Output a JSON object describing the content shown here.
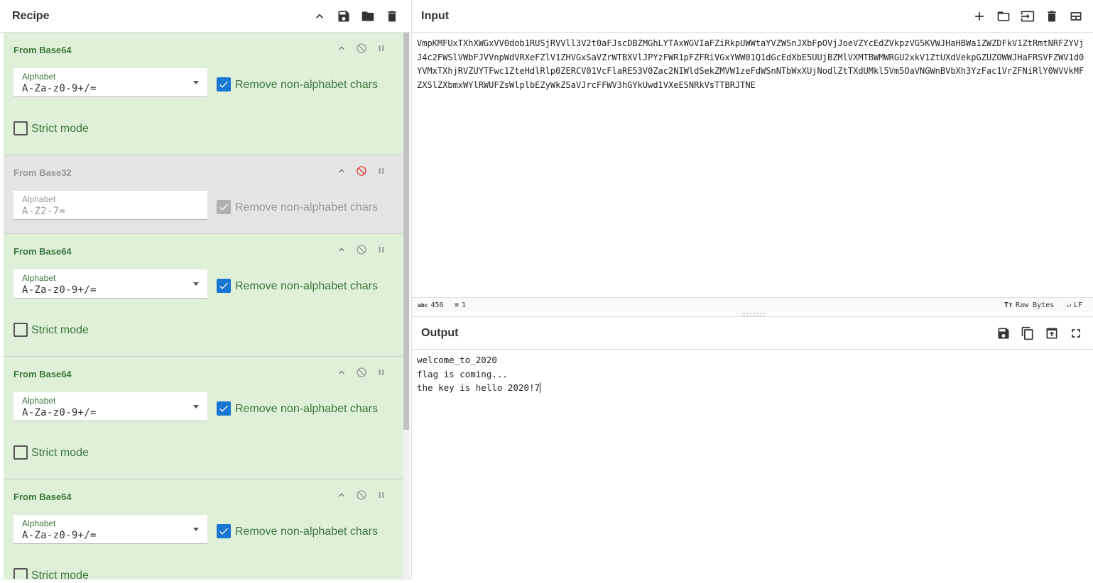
{
  "recipe": {
    "title": "Recipe",
    "header_icons": [
      "chevron-up-icon",
      "save-icon",
      "folder-icon",
      "trash-icon"
    ],
    "operations": [
      {
        "name": "From Base64",
        "disabled": false,
        "alphabet_label": "Alphabet",
        "alphabet": "A-Za-z0-9+/=",
        "remove_label": "Remove non-alphabet chars",
        "remove_checked": true,
        "strict_label": "Strict mode",
        "strict_checked": false
      },
      {
        "name": "From Base32",
        "disabled": true,
        "alphabet_label": "Alphabet",
        "alphabet": "A-Z2-7=",
        "remove_label": "Remove non-alphabet chars",
        "remove_checked": true
      },
      {
        "name": "From Base64",
        "disabled": false,
        "alphabet_label": "Alphabet",
        "alphabet": "A-Za-z0-9+/=",
        "remove_label": "Remove non-alphabet chars",
        "remove_checked": true,
        "strict_label": "Strict mode",
        "strict_checked": false
      },
      {
        "name": "From Base64",
        "disabled": false,
        "alphabet_label": "Alphabet",
        "alphabet": "A-Za-z0-9+/=",
        "remove_label": "Remove non-alphabet chars",
        "remove_checked": true,
        "strict_label": "Strict mode",
        "strict_checked": false
      },
      {
        "name": "From Base64",
        "disabled": false,
        "alphabet_label": "Alphabet",
        "alphabet": "A-Za-z0-9+/=",
        "remove_label": "Remove non-alphabet chars",
        "remove_checked": true,
        "strict_label": "Strict mode",
        "strict_checked": false
      }
    ]
  },
  "input": {
    "title": "Input",
    "header_icons": [
      "plus-icon",
      "folder-icon",
      "import-icon",
      "trash-icon",
      "layout-icon"
    ],
    "text": "VmpKMFUxTXhXWGxVV0dob1RUSjRVVll3V2t0aFJscDBZMGhLYTAxWGVIaFZiRkpUWWtaYVZWSnJXbFpOVjJoeVZYcEdZVkpzVG5KVWJHaHBWa1ZWZDFkV1ZtRmtNRFZYVjJ4c2FWSlVWbFJVVnpWdVRXeFZlV1ZHVGxSaVZrWTBXVlJPYzFWR1pFZFRiVGxYWW01Q1dGcEdXbE5UUjBZMlVXMTBWMWRGU2xkV1ZtUXdVekpGZUZOWWJHaFRSVFZWV1d0YVMxTXhjRVZUYTFwc1ZteHdlRlp0ZERCV01VcFlaRE53V0Zac2NIWldSekZMVW1zeFdWSnNTbWxXUjNodlZtTXdUMkl5Vm5OaVNGWnBVbXh3YzFac1VrZFNiRlY0WVVkMFZXSlZXbmxWYlRWUFZsWlplbEZyWkZSaVJrcFFWV3hGYkUwd1VXeE5NRkVsTTBRJTNE",
    "status": {
      "chars": "456",
      "lines": "1",
      "encoding": "Raw Bytes",
      "eol": "LF"
    }
  },
  "output": {
    "title": "Output",
    "header_icons": [
      "save-icon",
      "copy-icon",
      "replace-input-icon",
      "maximize-icon"
    ],
    "text": "welcome_to_2020\nflag is coming...\nthe key is hello 2020!7"
  }
}
